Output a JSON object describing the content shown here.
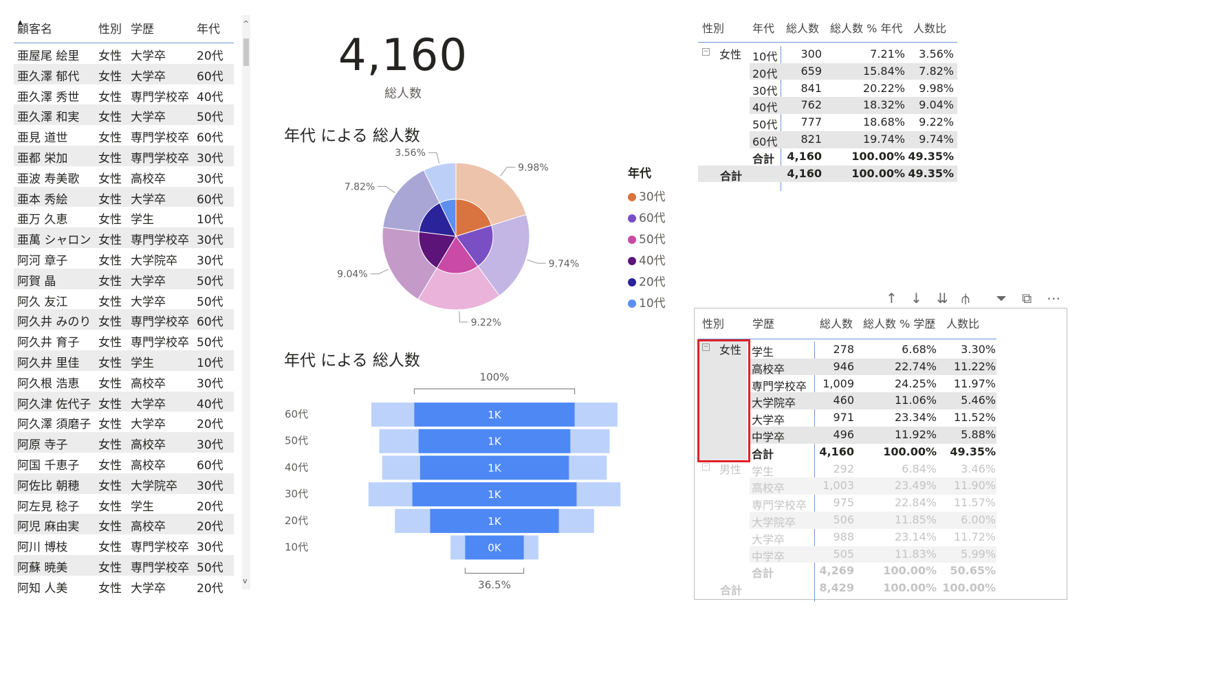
{
  "customers": {
    "headers": [
      "顧客名",
      "性別",
      "学歴",
      "年代"
    ],
    "rows": [
      [
        "亜屋尾 絵里",
        "女性",
        "大学卒",
        "20代"
      ],
      [
        "亜久澤 郁代",
        "女性",
        "大学卒",
        "60代"
      ],
      [
        "亜久澤 秀世",
        "女性",
        "専門学校卒",
        "40代"
      ],
      [
        "亜久澤 和実",
        "女性",
        "大学卒",
        "50代"
      ],
      [
        "亜見 道世",
        "女性",
        "専門学校卒",
        "60代"
      ],
      [
        "亜都 栄加",
        "女性",
        "専門学校卒",
        "30代"
      ],
      [
        "亜波 寿美歌",
        "女性",
        "高校卒",
        "30代"
      ],
      [
        "亜本 秀絵",
        "女性",
        "大学卒",
        "60代"
      ],
      [
        "亜万 久恵",
        "女性",
        "学生",
        "10代"
      ],
      [
        "亜萬 シャロン",
        "女性",
        "専門学校卒",
        "30代"
      ],
      [
        "阿河 章子",
        "女性",
        "大学院卒",
        "30代"
      ],
      [
        "阿賀 晶",
        "女性",
        "大学卒",
        "50代"
      ],
      [
        "阿久 友江",
        "女性",
        "大学卒",
        "50代"
      ],
      [
        "阿久井 みのり",
        "女性",
        "専門学校卒",
        "60代"
      ],
      [
        "阿久井 育子",
        "女性",
        "専門学校卒",
        "50代"
      ],
      [
        "阿久井 里佳",
        "女性",
        "学生",
        "10代"
      ],
      [
        "阿久根 浩恵",
        "女性",
        "高校卒",
        "30代"
      ],
      [
        "阿久津 佐代子",
        "女性",
        "大学卒",
        "40代"
      ],
      [
        "阿久澤 須磨子",
        "女性",
        "大学卒",
        "20代"
      ],
      [
        "阿原 寺子",
        "女性",
        "高校卒",
        "30代"
      ],
      [
        "阿国 千恵子",
        "女性",
        "高校卒",
        "60代"
      ],
      [
        "阿佐比 朝穂",
        "女性",
        "大学院卒",
        "30代"
      ],
      [
        "阿左見 稔子",
        "女性",
        "学生",
        "20代"
      ],
      [
        "阿児 麻由実",
        "女性",
        "高校卒",
        "20代"
      ],
      [
        "阿川 博枝",
        "女性",
        "専門学校卒",
        "30代"
      ],
      [
        "阿蘇 暁美",
        "女性",
        "専門学校卒",
        "50代"
      ],
      [
        "阿知 人美",
        "女性",
        "大学卒",
        "20代"
      ]
    ]
  },
  "kpi": {
    "value": "4,160",
    "label": "総人数"
  },
  "pie_title": "年代 による 総人数",
  "funnel_title": "年代 による 総人数",
  "legend": {
    "title": "年代",
    "items": [
      {
        "label": "30代",
        "color": "#d9733f"
      },
      {
        "label": "60代",
        "color": "#7b4fc4"
      },
      {
        "label": "50代",
        "color": "#c94ba6"
      },
      {
        "label": "40代",
        "color": "#5c1478"
      },
      {
        "label": "20代",
        "color": "#2b2399"
      },
      {
        "label": "10代",
        "color": "#5b8ff0"
      }
    ]
  },
  "matrix1": {
    "headers": [
      "性別",
      "年代",
      "総人数",
      "総人数 % 年代",
      "人数比"
    ],
    "group": "女性",
    "rows": [
      [
        "10代",
        "300",
        "7.21%",
        "3.56%"
      ],
      [
        "20代",
        "659",
        "15.84%",
        "7.82%"
      ],
      [
        "30代",
        "841",
        "20.22%",
        "9.98%"
      ],
      [
        "40代",
        "762",
        "18.32%",
        "9.04%"
      ],
      [
        "50代",
        "777",
        "18.68%",
        "9.22%"
      ],
      [
        "60代",
        "821",
        "19.74%",
        "9.74%"
      ]
    ],
    "subtotal": [
      "合計",
      "4,160",
      "100.00%",
      "49.35%"
    ],
    "total": [
      "合計",
      "4,160",
      "100.00%",
      "49.35%"
    ]
  },
  "matrix2": {
    "headers": [
      "性別",
      "学歴",
      "総人数",
      "総人数 % 学歴",
      "人数比"
    ],
    "groups": [
      {
        "name": "女性",
        "rows": [
          [
            "学生",
            "278",
            "6.68%",
            "3.30%"
          ],
          [
            "高校卒",
            "946",
            "22.74%",
            "11.22%"
          ],
          [
            "専門学校卒",
            "1,009",
            "24.25%",
            "11.97%"
          ],
          [
            "大学院卒",
            "460",
            "11.06%",
            "5.46%"
          ],
          [
            "大学卒",
            "971",
            "23.34%",
            "11.52%"
          ],
          [
            "中学卒",
            "496",
            "11.92%",
            "5.88%"
          ]
        ],
        "subtotal": [
          "合計",
          "4,160",
          "100.00%",
          "49.35%"
        ]
      },
      {
        "name": "男性",
        "rows": [
          [
            "学生",
            "292",
            "6.84%",
            "3.46%"
          ],
          [
            "高校卒",
            "1,003",
            "23.49%",
            "11.90%"
          ],
          [
            "専門学校卒",
            "975",
            "22.84%",
            "11.57%"
          ],
          [
            "大学院卒",
            "506",
            "11.85%",
            "6.00%"
          ],
          [
            "大学卒",
            "988",
            "23.14%",
            "11.72%"
          ],
          [
            "中学卒",
            "505",
            "11.83%",
            "5.99%"
          ]
        ],
        "subtotal": [
          "合計",
          "4,269",
          "100.00%",
          "50.65%"
        ]
      }
    ],
    "total": [
      "合計",
      "8,429",
      "100.00%",
      "100.00%"
    ]
  },
  "chart_data": [
    {
      "type": "pie",
      "title": "年代 による 総人数",
      "legend_title": "年代",
      "legend_position": "right",
      "inner_ring": [
        {
          "label": "30代",
          "value": 841,
          "color": "#d9733f"
        },
        {
          "label": "60代",
          "value": 821,
          "color": "#7b4fc4"
        },
        {
          "label": "50代",
          "value": 777,
          "color": "#c94ba6"
        },
        {
          "label": "40代",
          "value": 762,
          "color": "#5c1478"
        },
        {
          "label": "20代",
          "value": 659,
          "color": "#2b2399"
        },
        {
          "label": "10代",
          "value": 300,
          "color": "#5b8ff0"
        }
      ],
      "outer_ring": [
        {
          "label": "30代",
          "value": 9.98,
          "color": "#edc3ab"
        },
        {
          "label": "60代",
          "value": 9.74,
          "color": "#c3b5e4"
        },
        {
          "label": "50代",
          "value": 9.22,
          "color": "#e9b3da"
        },
        {
          "label": "40代",
          "value": 9.04,
          "color": "#c49ac9"
        },
        {
          "label": "20代",
          "value": 7.82,
          "color": "#a9a6d6"
        },
        {
          "label": "10代",
          "value": 3.56,
          "color": "#bcd0f7"
        }
      ],
      "data_labels": [
        "9.98%",
        "9.74%",
        "9.22%",
        "9.04%",
        "7.82%",
        "3.56%"
      ]
    },
    {
      "type": "bar",
      "subtype": "funnel",
      "title": "年代 による 総人数",
      "categories": [
        "60代",
        "50代",
        "40代",
        "30代",
        "20代",
        "10代"
      ],
      "values": [
        821,
        777,
        762,
        841,
        659,
        300
      ],
      "labels": [
        "1K",
        "1K",
        "1K",
        "1K",
        "1K",
        "0K"
      ],
      "background_values": [
        1260,
        1180,
        1150,
        1290,
        1020,
        450
      ],
      "colors": {
        "bar": "#4d88f5",
        "background": "#bcd2fb"
      },
      "top_label": "100%",
      "bottom_label": "36.5%"
    }
  ],
  "toolbar_icons": [
    "arrow-up-icon",
    "arrow-down-icon",
    "double-arrow-down-icon",
    "expand-hierarchy-icon",
    "filter-icon",
    "focus-mode-icon",
    "more-options-icon"
  ]
}
